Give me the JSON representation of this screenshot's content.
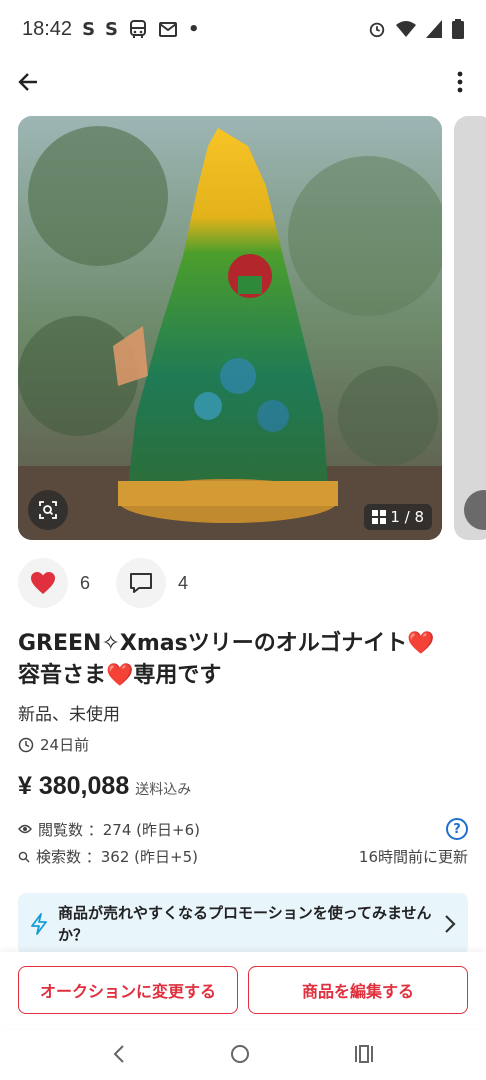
{
  "status_bar": {
    "time": "18:42",
    "left_icons": [
      "S",
      "S",
      "bus-icon",
      "mail-icon",
      "•"
    ],
    "right_icons": [
      "alarm-icon",
      "wifi-icon",
      "signal-icon",
      "battery-icon"
    ]
  },
  "gallery": {
    "page_indicator": "1 / 8"
  },
  "actions": {
    "like_count": "6",
    "comment_count": "4"
  },
  "item": {
    "title_line1": "GREEN✧Xmasツリーのオルゴナイト❤️",
    "title_line2": "容音さま❤️専用です",
    "condition": "新品、未使用",
    "posted": "24日前",
    "price": "¥ 380,088",
    "shipping": "送料込み"
  },
  "stats": {
    "views_label": "閲覧数 ：274 (昨日+6)",
    "search_label": "検索数 ：362 (昨日+5)",
    "updated": "16時間前に更新"
  },
  "promo": {
    "text": "商品が売れやすくなるプロモーションを使ってみませんか？"
  },
  "bottom_actions": {
    "auction_label": "オークションに変更する",
    "edit_label": "商品を編集する"
  },
  "colors": {
    "accent": "#e0303e",
    "promo_bg": "#e8f5fb",
    "link_blue": "#1f6fd1"
  }
}
